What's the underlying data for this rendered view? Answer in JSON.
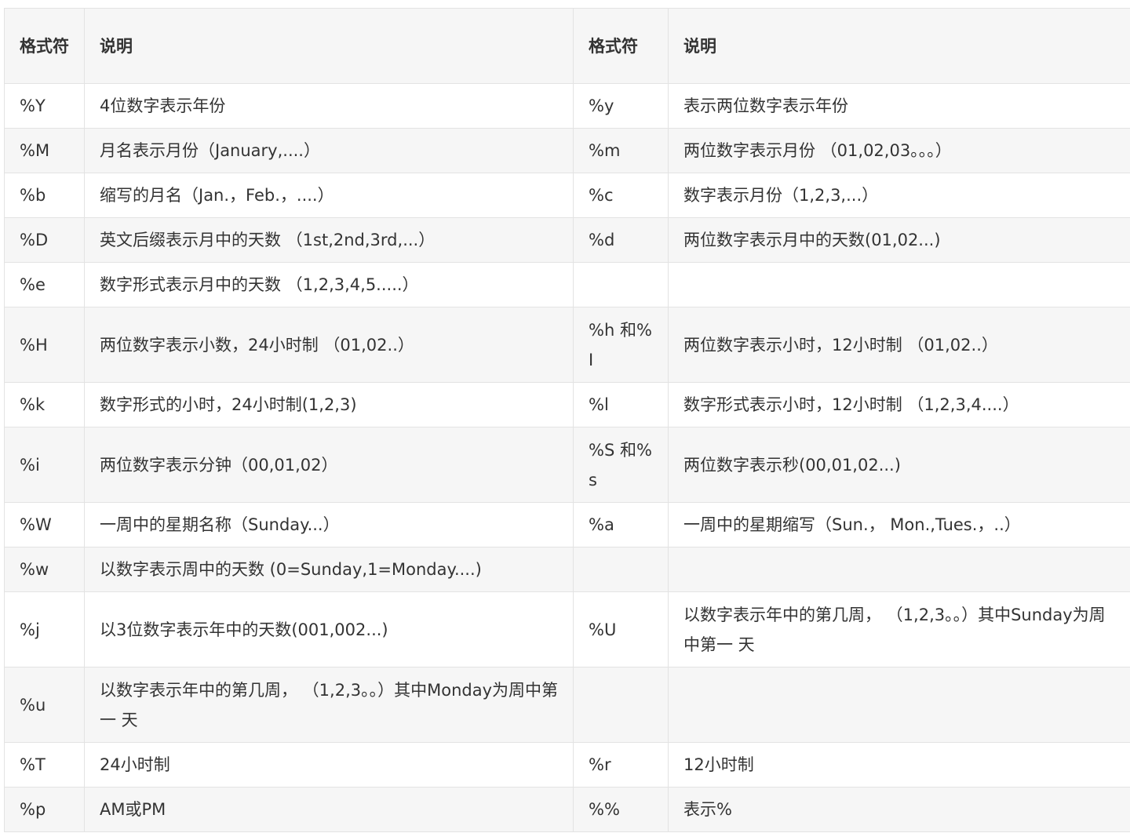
{
  "table": {
    "headers": [
      "格式符",
      "说明",
      "格式符",
      "说明"
    ],
    "rows": [
      {
        "f1": "%Y",
        "d1": "4位数字表示年份",
        "f2": "%y",
        "d2": "表示两位数字表示年份"
      },
      {
        "f1": "%M",
        "d1": "月名表示月份（January,....）",
        "f2": "%m",
        "d2": "两位数字表示月份 （01,02,03。。。）"
      },
      {
        "f1": "%b",
        "d1": "缩写的月名（Jan.，Feb.，....）",
        "f2": "%c",
        "d2": "数字表示月份（1,2,3,...）"
      },
      {
        "f1": "%D",
        "d1": "英文后缀表示月中的天数 （1st,2nd,3rd,...）",
        "f2": "%d",
        "d2": "两位数字表示月中的天数(01,02...)"
      },
      {
        "f1": "%e",
        "d1": "数字形式表示月中的天数 （1,2,3,4,5.....）",
        "f2": "",
        "d2": ""
      },
      {
        "f1": "%H",
        "d1": "两位数字表示小数，24小时制 （01,02..）",
        "f2": "%h 和%I",
        "d2": "两位数字表示小时，12小时制 （01,02..）"
      },
      {
        "f1": "%k",
        "d1": "数字形式的小时，24小时制(1,2,3)",
        "f2": "%l",
        "d2": "数字形式表示小时，12小时制 （1,2,3,4....）"
      },
      {
        "f1": "%i",
        "d1": "两位数字表示分钟（00,01,02）",
        "f2": "%S 和%s",
        "d2": "两位数字表示秒(00,01,02...)"
      },
      {
        "f1": "%W",
        "d1": "一周中的星期名称（Sunday...）",
        "f2": "%a",
        "d2": "一周中的星期缩写（Sun.， Mon.,Tues.，..）"
      },
      {
        "f1": "%w",
        "d1": "以数字表示周中的天数 (0=Sunday,1=Monday....)",
        "f2": "",
        "d2": ""
      },
      {
        "f1": "%j",
        "d1": "以3位数字表示年中的天数(001,002...)",
        "f2": "%U",
        "d2": "以数字表示年中的第几周， （1,2,3。。）其中Sunday为周中第一 天"
      },
      {
        "f1": "%u",
        "d1": "以数字表示年中的第几周， （1,2,3。。）其中Monday为周中第一 天",
        "f2": "",
        "d2": ""
      },
      {
        "f1": "%T",
        "d1": "24小时制",
        "f2": "%r",
        "d2": "12小时制"
      },
      {
        "f1": "%p",
        "d1": "AM或PM",
        "f2": "%%",
        "d2": "表示%"
      }
    ]
  }
}
